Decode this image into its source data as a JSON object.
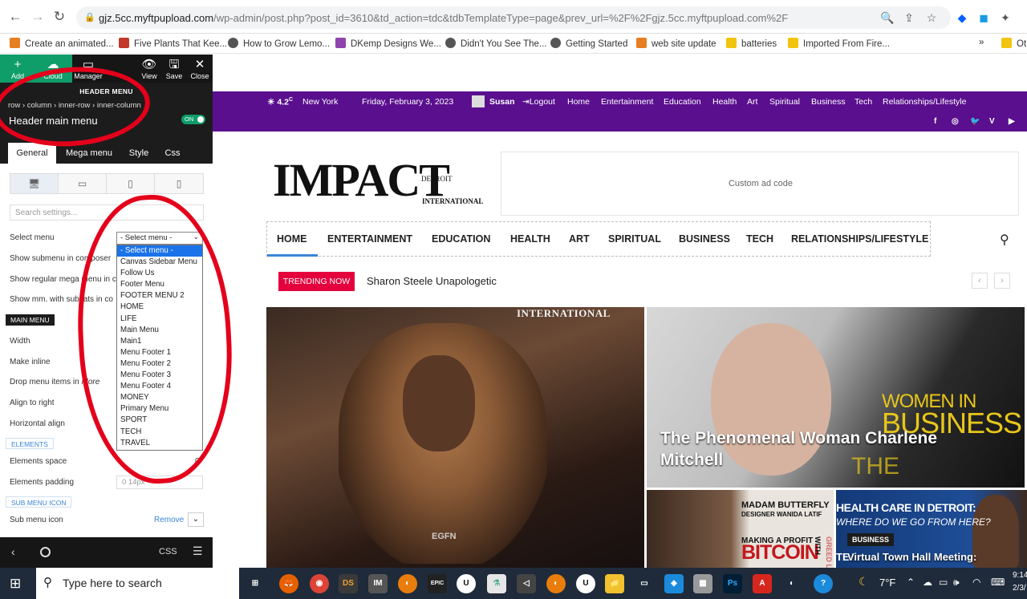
{
  "browser": {
    "url_host": "gjz.5cc.myftpupload.com",
    "url_rest": "/wp-admin/post.php?post_id=3610&td_action=tdc&tdbTemplateType=page&prev_url=%2F%2Fgjz.5cc.myftpupload.com%2F",
    "bookmarks": [
      "Create an animated...",
      "Five Plants That Kee...",
      "How to Grow Lemo...",
      "DKemp Designs We...",
      "Didn't You See The...",
      "Getting Started",
      "web site update",
      "batteries",
      "Imported From Fire..."
    ],
    "bookmarks_more": "»",
    "bookmarks_last": "Ot"
  },
  "editor": {
    "tools": [
      {
        "label": "Add",
        "glyph": "+"
      },
      {
        "label": "Cloud",
        "glyph": "☁"
      },
      {
        "label": "Manager",
        "glyph": "▭"
      }
    ],
    "tools_right": [
      {
        "label": "View",
        "glyph": "👁"
      },
      {
        "label": "Save",
        "glyph": "🖫"
      },
      {
        "label": "Close",
        "glyph": "✕"
      }
    ],
    "block_title": "HEADER MENU",
    "breadcrumbs": "row › column › inner-row › inner-column",
    "block_name": "Header main menu",
    "toggle": "ON",
    "tabs": [
      "General",
      "Mega menu",
      "Style",
      "Css"
    ],
    "search_placeholder": "Search settings...",
    "settings": {
      "select_menu": "Select menu",
      "show_submenu": "Show submenu in composer",
      "show_regular": "Show regular mega menu in c",
      "show_mm": "Show mm. with subcats in co",
      "main_menu_head": "MAIN MENU",
      "width": "Width",
      "make_inline": "Make inline",
      "drop_menu": "Drop menu items in",
      "drop_more": "More",
      "align_right": "Align to right",
      "h_align": "Horizontal align",
      "elements_head": "ELEMENTS",
      "elements_space": "Elements space",
      "elements_space_val": "0",
      "elements_padding": "Elements padding",
      "padding_placeholder": "0 14px",
      "sub_menu_icon_head": "SUB MENU ICON",
      "sub_menu_icon": "Sub menu icon",
      "remove": "Remove"
    },
    "select_value": "- Select menu -",
    "dropdown_options": [
      "- Select menu -",
      "Canvas Sidebar Menu",
      "Follow Us",
      "Footer Menu",
      "FOOTER MENU 2",
      "HOME",
      "LIFE",
      "Main Menu",
      "Main1",
      "Menu Footer 1",
      "Menu Footer 2",
      "Menu Footer 3",
      "Menu Footer 4",
      "MONEY",
      "Primary Menu",
      "SPORT",
      "TECH",
      "TRAVEL"
    ],
    "bottom_css": "CSS"
  },
  "site": {
    "weather": "4.2",
    "weather_unit": "C",
    "city": "New York",
    "date": "Friday, February 3, 2023",
    "user": "Susan",
    "logout": "Logout",
    "top_links": [
      "Home",
      "Entertainment",
      "Education",
      "Health",
      "Art",
      "Spiritual",
      "Business",
      "Tech",
      "Relationships/Lifestyle"
    ],
    "social": [
      "f",
      "◎",
      "🐦",
      "V",
      "▶"
    ],
    "logo_main": "IMPACT",
    "logo_detroit": "DETROIT",
    "logo_intl": "INTERNATIONAL",
    "ad_text": "Custom ad code",
    "main_menu": [
      "HOME",
      "ENTERTAINMENT",
      "EDUCATION",
      "HEALTH",
      "ART",
      "SPIRITUAL",
      "BUSINESS",
      "TECH",
      "RELATIONSHIPS/LIFESTYLE"
    ],
    "trending_label": "TRENDING NOW",
    "trending_text": "Sharon Steele Unapologetic",
    "img_intl": "INTERNATIONAL",
    "necklace": "EGFN",
    "women_in": "WOMEN IN",
    "business_big": "BUSINESS",
    "the_text": "THE",
    "feature_caption": "The Phenomenal Woman Charlene Mitchell",
    "madam": "MADAM BUTTERFLY",
    "designer": "DESIGNER WANIDA LATIF",
    "making": "MAKING A PROFIT",
    "bitcoin": "BITCOIN",
    "with": "WITH",
    "greed": "GREED LEAKS",
    "hc_title": "HEALTH CARE IN DETROIT:",
    "hc_sub": "WHERE DO WE GO FROM HERE?",
    "biz_badge": "BUSINESS",
    "townhall": "Virtual Town Hall Meeting:",
    "te_prefix": "TE"
  },
  "taskbar": {
    "search": "Type here to search",
    "apps": [
      "⊞",
      "🦊",
      "◉",
      "DS",
      "IM",
      "◐",
      "EPIC",
      "U",
      "⚗",
      "◁",
      "◐",
      "U",
      "📁",
      "▭",
      "◈",
      "▦",
      "Ps",
      "A",
      "◐",
      "?"
    ],
    "temp": "7°F",
    "time": "9:14",
    "date": "2/3/"
  }
}
